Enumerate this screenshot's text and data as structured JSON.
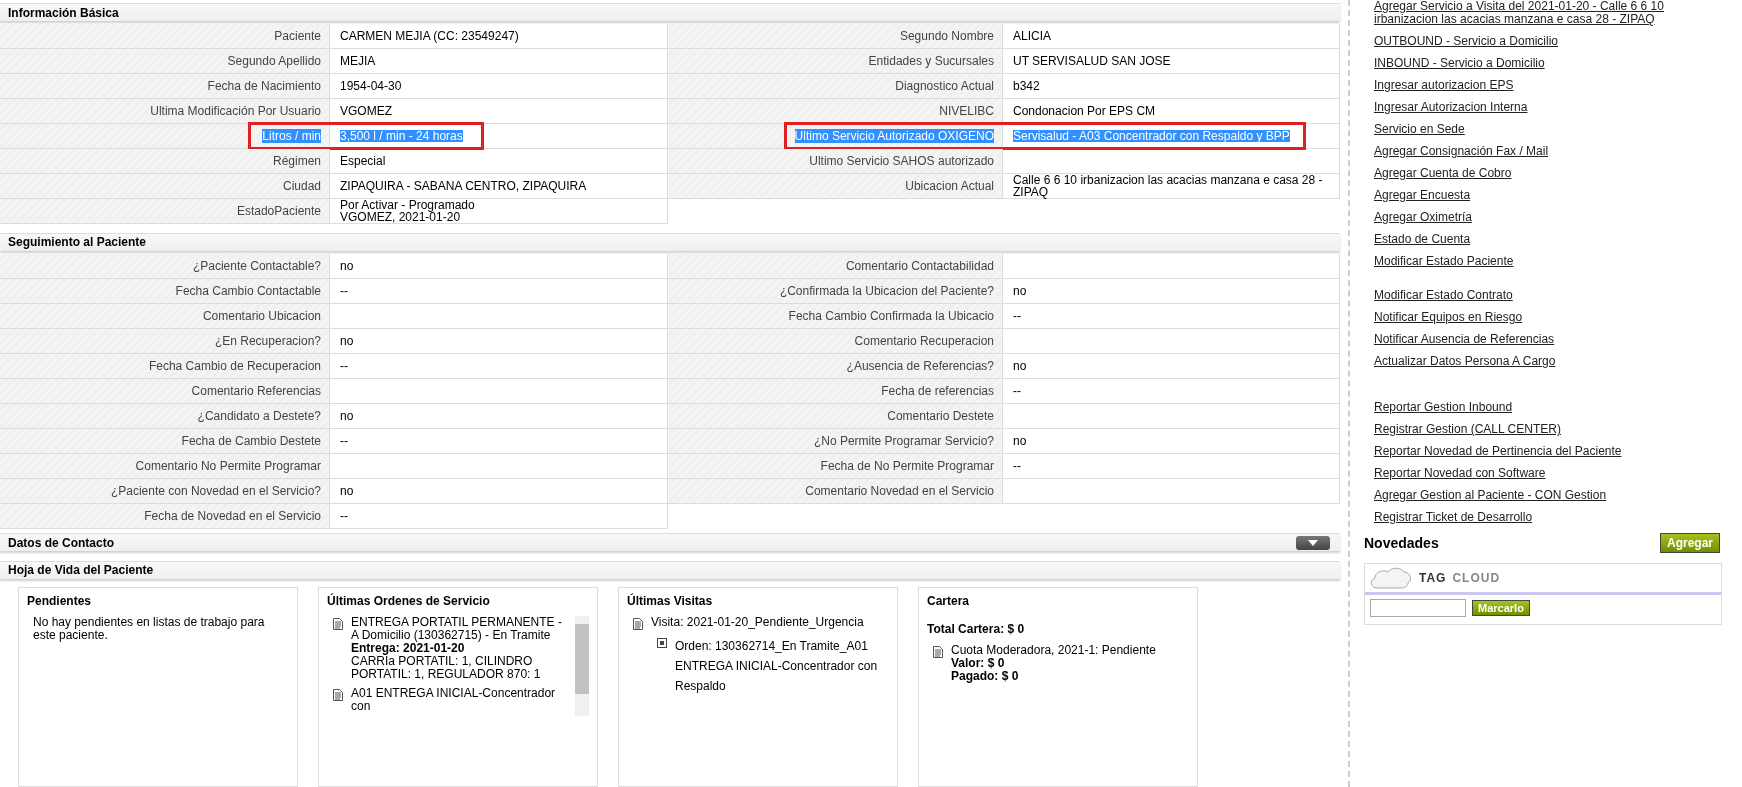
{
  "info": {
    "title": "Información Básica",
    "left": [
      {
        "label": "Paciente",
        "value": "CARMEN MEJIA (CC: 23549247)",
        "highlighted": false
      },
      {
        "label": "Segundo Apellido",
        "value": "MEJIA",
        "highlighted": false
      },
      {
        "label": "Fecha de Nacimiento",
        "value": "1954-04-30",
        "highlighted": false
      },
      {
        "label": "Ultima Modificación Por Usuario",
        "value": "VGOMEZ",
        "highlighted": false
      },
      {
        "label": "Litros / min",
        "value": "3,500 l / min - 24 horas",
        "highlighted": true
      },
      {
        "label": "Régimen",
        "value": "Especial",
        "highlighted": false
      },
      {
        "label": "Ciudad",
        "value": "ZIPAQUIRA - SABANA CENTRO, ZIPAQUIRA",
        "highlighted": false
      },
      {
        "label": "EstadoPaciente",
        "value": "Por Activar - Programado\nVGOMEZ, 2021-01-20",
        "highlighted": false
      }
    ],
    "right": [
      {
        "label": "Segundo Nombre",
        "value": "ALICIA",
        "highlighted": false
      },
      {
        "label": "Entidades y Sucursales",
        "value": "UT SERVISALUD SAN JOSE",
        "highlighted": false
      },
      {
        "label": "Diagnostico Actual",
        "value": "b342",
        "highlighted": false
      },
      {
        "label": "NIVELIBC",
        "value": "Condonacion Por EPS CM",
        "highlighted": false
      },
      {
        "label": "Ultimo Servicio Autorizado OXIGENO",
        "value": "Servisalud - A03 Concentrador con Respaldo y BPP",
        "highlighted": true
      },
      {
        "label": "Ultimo Servicio SAHOS autorizado",
        "highlighted": false
      },
      {
        "label": "Ubicacion Actual",
        "value": "Calle 6 6 10 irbanizacion las acacias manzana e casa 28 - ZIPAQ",
        "highlighted": false
      }
    ]
  },
  "seguimiento": {
    "title": "Seguimiento al Paciente",
    "left": [
      {
        "label": "¿Paciente Contactable?",
        "value": "no"
      },
      {
        "label": "Fecha Cambio Contactable",
        "value": "--"
      },
      {
        "label": "Comentario Ubicacion"
      },
      {
        "label": "¿En Recuperacion?",
        "value": "no"
      },
      {
        "label": "Fecha Cambio de Recuperacion",
        "value": "--"
      },
      {
        "label": "Comentario Referencias"
      },
      {
        "label": "¿Candidato a Destete?",
        "value": "no"
      },
      {
        "label": "Fecha de Cambio Destete",
        "value": "--"
      },
      {
        "label": "Comentario No Permite Programar"
      },
      {
        "label": "¿Paciente con Novedad en el Servicio?",
        "value": "no"
      },
      {
        "label": "Fecha de Novedad en el Servicio",
        "value": "--"
      }
    ],
    "right": [
      {
        "label": "Comentario Contactabilidad"
      },
      {
        "label": "¿Confirmada la Ubicacion del Paciente?",
        "value": "no"
      },
      {
        "label": "Fecha Cambio Confirmada la Ubicacio",
        "value": "--"
      },
      {
        "label": "Comentario Recuperacion"
      },
      {
        "label": "¿Ausencia de Referencias?",
        "value": "no"
      },
      {
        "label": "Fecha de referencias",
        "value": "--"
      },
      {
        "label": "Comentario Destete"
      },
      {
        "label": "¿No Permite Programar Servicio?",
        "value": "no"
      },
      {
        "label": "Fecha de No Permite Programar",
        "value": "--"
      },
      {
        "label": "Comentario Novedad en el Servicio"
      }
    ]
  },
  "contacto": {
    "title": "Datos de Contacto",
    "expanded": false
  },
  "hoja": {
    "title": "Hoja de Vida del Paciente",
    "pendientes": {
      "title": "Pendientes",
      "text": "No hay pendientes en listas de trabajo para este paciente."
    },
    "ordenes": {
      "title": "Últimas Ordenes de Servicio",
      "entries": [
        {
          "lines": [
            "ENTREGA PORTATIL PERMANENTE - A Domicilio (130362715) - En Tramite",
            "**Entrega:** **2021-01-20**",
            "CARRIa PORTATIL: 1, CILINDRO PORTATIL: 1, REGULADOR 870: 1"
          ]
        },
        {
          "lines": [
            "A01 ENTREGA INICIAL-Concentrador con"
          ]
        }
      ]
    },
    "visitas": {
      "title": "Últimas Visitas",
      "entries": [
        {
          "text": "Visita: 2021-01-20_Pendiente_Urgencia",
          "children": [
            {
              "text": "Orden: 130362714_En Tramite_A01 ENTREGA INICIAL-Concentrador con Respaldo"
            }
          ]
        }
      ]
    },
    "cartera": {
      "title": "Cartera",
      "total": "Total Cartera: $ 0",
      "entries": [
        {
          "lines": [
            "Cuota Moderadora, 2021-1: Pendiente",
            "**Valor: $ 0**",
            "**Pagado: $ 0**"
          ]
        }
      ]
    }
  },
  "sidebar": {
    "link_groups": [
      [
        "Agregar Servicio a Visita del 2021-01-20 - Calle 6 6 10 irbanizacion las acacias manzana e casa 28 - ZIPAQ",
        "OUTBOUND - Servicio a Domicilio",
        "INBOUND - Servicio a Domicilio",
        "Ingresar autorizacion EPS",
        "Ingresar Autorizacion Interna",
        "Servicio en Sede",
        "Agregar Consignación Fax / Mail",
        "Agregar Cuenta de Cobro",
        "Agregar Encuesta",
        "Agregar Oximetría",
        "Estado de Cuenta",
        "Modificar Estado Paciente"
      ],
      [
        "Modificar Estado Contrato",
        "Notificar Equipos en Riesgo",
        "Notificar Ausencia de Referencias",
        "Actualizar Datos Persona A Cargo"
      ],
      [
        "Reportar Gestion Inbound",
        "Registrar Gestion (CALL CENTER)",
        "Reportar Novedad de Pertinencia del Paciente",
        "Reportar Novedad con Software",
        "Agregar Gestion al Paciente - CON Gestion",
        "Registrar Ticket de Desarrollo"
      ]
    ],
    "novedades": {
      "title": "Novedades",
      "button": "Agregar",
      "tag_word": "TAG",
      "cloud_word": "CLOUD",
      "mark_button": "Marcarlo"
    }
  }
}
